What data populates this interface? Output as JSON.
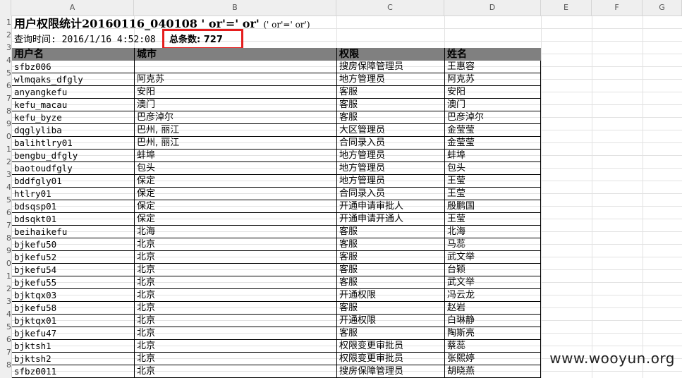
{
  "columns": [
    "A",
    "B",
    "C",
    "D",
    "E",
    "F",
    "G"
  ],
  "row_numbers": [
    "1",
    "2",
    "3",
    "4",
    "5",
    "6",
    "7",
    "8",
    "9",
    "0",
    "1",
    "2",
    "3",
    "4",
    "5",
    "6",
    "7",
    "8",
    "9",
    "0",
    "1",
    "2",
    "3",
    "4",
    "5",
    "6",
    "7",
    "8"
  ],
  "title": {
    "main": "用户权限统计20160116_040108 ' or'=' or'",
    "sub": "(' or'=' or')"
  },
  "query_time": "查询时间: 2016/1/16 4:52:08",
  "total_count": "总条数: 727",
  "headers": [
    "用户名",
    "城市",
    "权限",
    "姓名"
  ],
  "rows": [
    [
      "sfbz006",
      "",
      "搜房保障管理员",
      "王惠容"
    ],
    [
      "wlmqaks_dfgly",
      "阿克苏",
      "地方管理员",
      "阿克苏"
    ],
    [
      "anyangkefu",
      "安阳",
      "客服",
      "安阳"
    ],
    [
      "kefu_macau",
      "澳门",
      "客服",
      "澳门"
    ],
    [
      "kefu_byze",
      "巴彦淖尔",
      "客服",
      "巴彦淖尔"
    ],
    [
      "dqglyliba",
      "巴州, 丽江",
      "大区管理员",
      "金莹莹"
    ],
    [
      "balihtlry01",
      "巴州, 丽江",
      "合同录入员",
      "金莹莹"
    ],
    [
      "bengbu_dfgly",
      "蚌埠",
      "地方管理员",
      "蚌埠"
    ],
    [
      "baotoudfgly",
      "包头",
      "地方管理员",
      "包头"
    ],
    [
      "bddfgly01",
      "保定",
      "地方管理员",
      "王莹"
    ],
    [
      "htlry01",
      "保定",
      "合同录入员",
      "王莹"
    ],
    [
      "bdsqsp01",
      "保定",
      "开通申请审批人",
      "殷鹏国"
    ],
    [
      "bdsqkt01",
      "保定",
      "开通申请开通人",
      "王莹"
    ],
    [
      "beihaikefu",
      "北海",
      "客服",
      "北海"
    ],
    [
      "bjkefu50",
      "北京",
      "客服",
      "马蕊"
    ],
    [
      "bjkefu52",
      "北京",
      "客服",
      "武文举"
    ],
    [
      "bjkefu54",
      "北京",
      "客服",
      "台颖"
    ],
    [
      "bjkefu55",
      "北京",
      "客服",
      "武文举"
    ],
    [
      "bjktqx03",
      "北京",
      "开通权限",
      "冯云龙"
    ],
    [
      "bjkefu58",
      "北京",
      "客服",
      "赵岩"
    ],
    [
      "bjktqx01",
      "北京",
      "开通权限",
      "白琳静"
    ],
    [
      "bjkefu47",
      "北京",
      "客服",
      "陶斯亮"
    ],
    [
      "bjktsh1",
      "北京",
      "权限变更审批员",
      "蔡蕊"
    ],
    [
      "bjktsh2",
      "北京",
      "权限变更审批员",
      "张熙婷"
    ],
    [
      "sfbz0011",
      "北京",
      "搜房保障管理员",
      "胡晓燕"
    ]
  ],
  "watermark": "www.wooyun.org"
}
